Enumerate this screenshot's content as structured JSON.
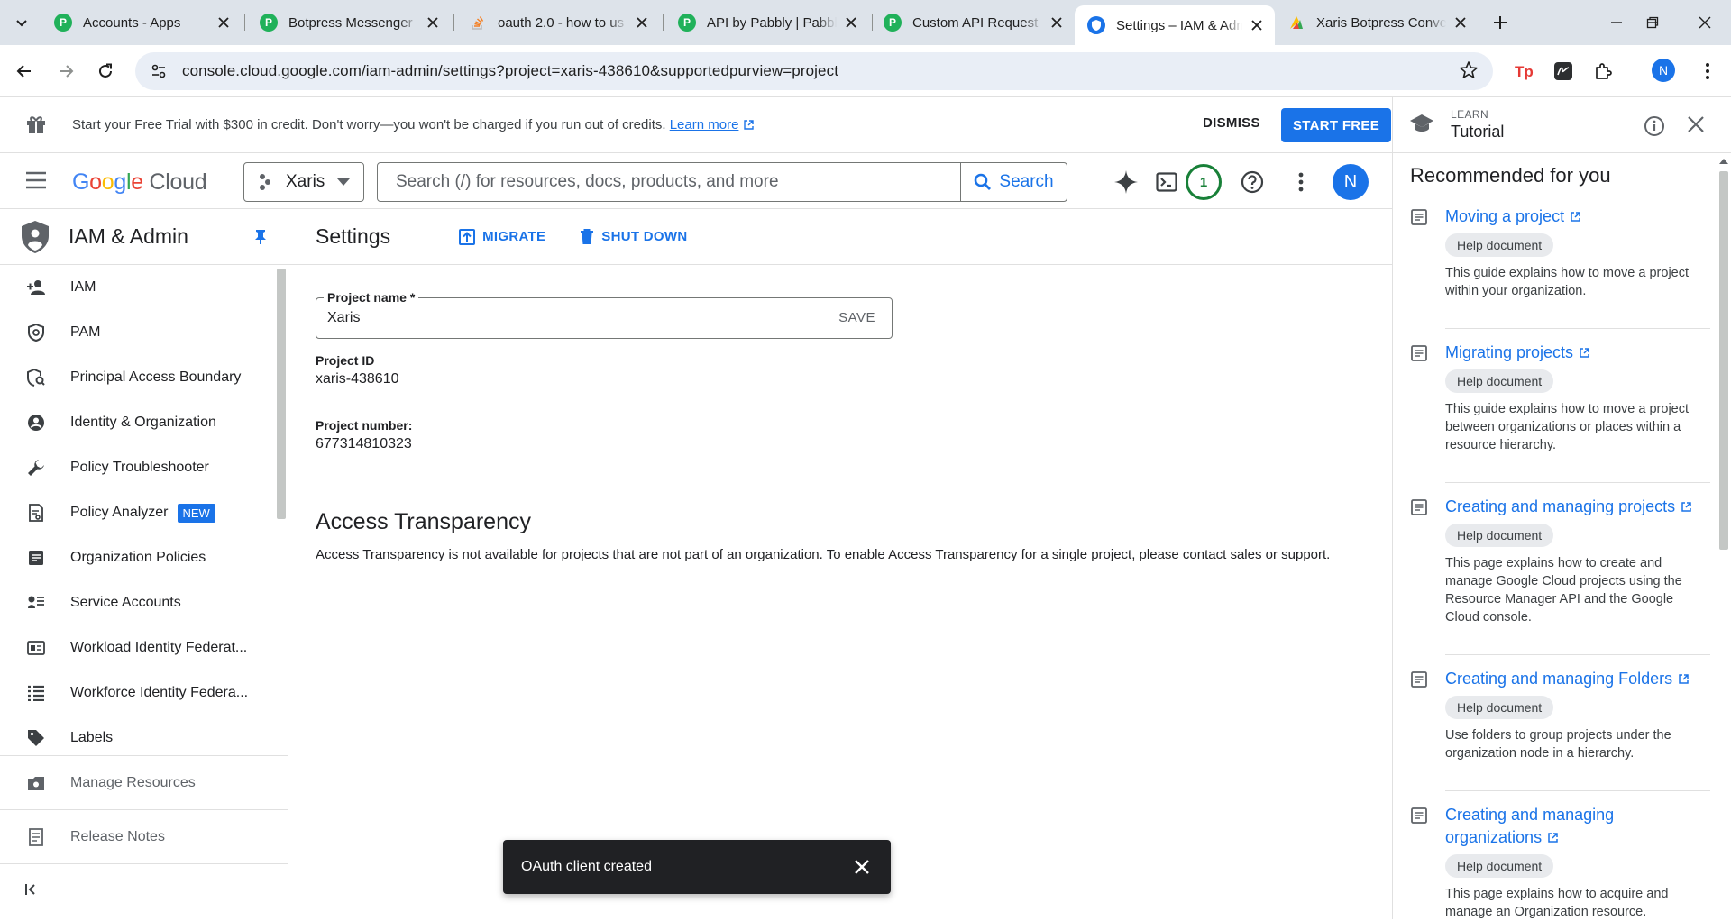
{
  "browser": {
    "tabs": [
      {
        "title": "Accounts - Apps",
        "icon": "pabbly-icon"
      },
      {
        "title": "Botpress Messenger",
        "icon": "pabbly-icon"
      },
      {
        "title": "oauth 2.0 - how to us",
        "icon": "stackoverflow-icon"
      },
      {
        "title": "API by Pabbly | Pabbl",
        "icon": "pabbly-icon"
      },
      {
        "title": "Custom API Request",
        "icon": "pabbly-icon"
      },
      {
        "title": "Settings – IAM & Adm",
        "icon": "gcp-iam-icon"
      },
      {
        "title": "Xaris Botpress Conve",
        "icon": "google-sheets-icon"
      }
    ],
    "active_tab_index": 5,
    "url": "console.cloud.google.com/iam-admin/settings?project=xaris-438610&supportedpurview=project",
    "profile_initial": "N"
  },
  "banner": {
    "message": "Start your Free Trial with $300 in credit. Don't worry—you won't be charged if you run out of credits.",
    "learn_more": "Learn more",
    "dismiss": "DISMISS",
    "start_free": "START FREE"
  },
  "header": {
    "logo_google": "Google",
    "logo_cloud": "Cloud",
    "project": "Xaris",
    "search_placeholder": "Search (/) for resources, docs, products, and more",
    "search_button": "Search",
    "notifications_count": "1",
    "avatar_initial": "N"
  },
  "sidebar": {
    "title": "IAM & Admin",
    "items": [
      {
        "label": "IAM",
        "icon": "person-add-icon"
      },
      {
        "label": "PAM",
        "icon": "shield-clock-icon"
      },
      {
        "label": "Principal Access Boundary",
        "icon": "shield-search-icon"
      },
      {
        "label": "Identity & Organization",
        "icon": "account-circle-icon"
      },
      {
        "label": "Policy Troubleshooter",
        "icon": "wrench-icon"
      },
      {
        "label": "Policy Analyzer",
        "icon": "policy-analyzer-icon",
        "badge": "NEW"
      },
      {
        "label": "Organization Policies",
        "icon": "document-icon"
      },
      {
        "label": "Service Accounts",
        "icon": "service-account-icon"
      },
      {
        "label": "Workload Identity Federat...",
        "icon": "id-card-icon"
      },
      {
        "label": "Workforce Identity Federa...",
        "icon": "list-icon"
      },
      {
        "label": "Labels",
        "icon": "tag-icon"
      }
    ],
    "bottom": [
      {
        "label": "Manage Resources",
        "icon": "manage-resources-icon"
      },
      {
        "label": "Release Notes",
        "icon": "release-notes-icon"
      }
    ]
  },
  "page": {
    "title": "Settings",
    "migrate": "MIGRATE",
    "shutdown": "SHUT DOWN",
    "project_name_label": "Project name *",
    "project_name_value": "Xaris",
    "save": "SAVE",
    "project_id_label": "Project ID",
    "project_id_value": "xaris-438610",
    "project_number_label": "Project number:",
    "project_number_value": "677314810323",
    "access_title": "Access Transparency",
    "access_text": "Access Transparency is not available for projects that are not part of an organization. To enable Access Transparency for a single project, please contact sales or support."
  },
  "toast": {
    "message": "OAuth client created"
  },
  "tutorial": {
    "learn": "LEARN",
    "title": "Tutorial",
    "recommended": "Recommended for you",
    "cards": [
      {
        "title": "Moving a project",
        "chip": "Help document",
        "desc": "This guide explains how to move a project within your organization."
      },
      {
        "title": "Migrating projects",
        "chip": "Help document",
        "desc": "This guide explains how to move a project between organizations or places within a resource hierarchy."
      },
      {
        "title": "Creating and managing projects",
        "chip": "Help document",
        "desc": "This page explains how to create and manage Google Cloud projects using the Resource Manager API and the Google Cloud console."
      },
      {
        "title": "Creating and managing Folders",
        "chip": "Help document",
        "desc": "Use folders to group projects under the organization node in a hierarchy."
      },
      {
        "title": "Creating and managing organizations",
        "chip": "Help document",
        "desc": "This page explains how to acquire and manage an Organization resource."
      }
    ]
  },
  "colors": {
    "accent": "#1a73e8",
    "tabstrip": "#dde3ea",
    "notification": "#188038",
    "toast_bg": "#202124"
  }
}
